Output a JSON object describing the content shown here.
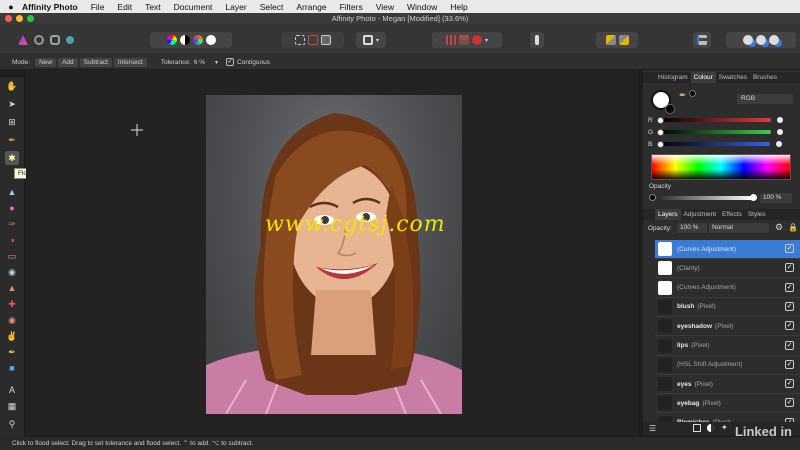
{
  "menubar": {
    "apple": "",
    "app_name": "Affinity Photo",
    "items": [
      "File",
      "Edit",
      "Text",
      "Document",
      "Layer",
      "Select",
      "Arrange",
      "Filters",
      "View",
      "Window",
      "Help"
    ]
  },
  "window": {
    "title": "Affinity Photo - Megan [Modified] (33.6%)"
  },
  "context_toolbar": {
    "mode_label": "Mode:",
    "mode_buttons": [
      "New",
      "Add",
      "Subtract",
      "Intersect"
    ],
    "tolerance_label": "Tolerance:",
    "tolerance_value": "6 %",
    "contiguous_label": "Contiguous",
    "contiguous_checked": true
  },
  "tooltip": {
    "text": "Flood Select Tool (W)"
  },
  "canvas": {
    "watermark": "www.cgtsj.com"
  },
  "right_panel": {
    "top_tabs": [
      "Histogram",
      "Colour",
      "Swatches",
      "Brushes"
    ],
    "active_top_tab": "Colour",
    "color_model": "RGB",
    "channels": [
      {
        "label": "R",
        "color": "#e53a3a"
      },
      {
        "label": "G",
        "color": "#3ad14a"
      },
      {
        "label": "B",
        "color": "#3a5ee5"
      }
    ],
    "opacity_label": "Opacity",
    "opacity_value": "100 %",
    "layer_tabs": [
      "Layers",
      "Adjustment",
      "Effects",
      "Styles"
    ],
    "active_layer_tab": "Layers",
    "layers_opacity_label": "Opacity:",
    "layers_opacity_value": "100 %",
    "blend_mode": "Normal",
    "layers": [
      {
        "name": "",
        "kind": "(Curves Adjustment)",
        "selected": true
      },
      {
        "name": "",
        "kind": "(Clarity)",
        "selected": false
      },
      {
        "name": "",
        "kind": "(Curves Adjustment)",
        "selected": false
      },
      {
        "name": "blush",
        "kind": "(Pixel)",
        "selected": false
      },
      {
        "name": "eyeshadow",
        "kind": "(Pixel)",
        "selected": false
      },
      {
        "name": "lips",
        "kind": "(Pixel)",
        "selected": false
      },
      {
        "name": "",
        "kind": "(HSL Shift Adjustment)",
        "selected": false
      },
      {
        "name": "eyes",
        "kind": "(Pixel)",
        "selected": false
      },
      {
        "name": "eyebag",
        "kind": "(Pixel)",
        "selected": false
      },
      {
        "name": "Blemishes",
        "kind": "(Pixel)",
        "selected": false
      }
    ]
  },
  "status_bar": {
    "text": "Click to flood select. Drag to set tolerance and flood select. ⌃ to add. ⌥ to subtract."
  },
  "brand": {
    "watermark": "Linked in"
  },
  "colors": {
    "accent": "#3a7bd5",
    "watermark": "#f2e600"
  }
}
